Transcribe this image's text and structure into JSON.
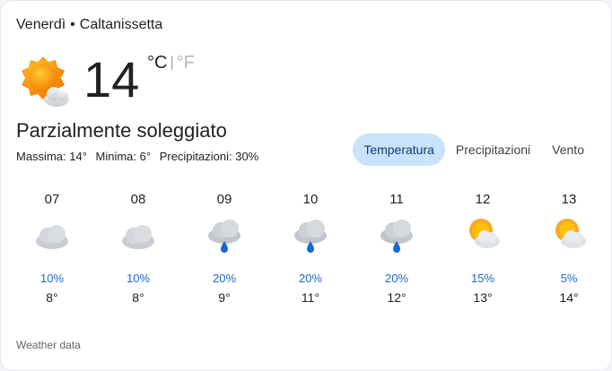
{
  "header": {
    "day": "Venerdì",
    "separator": "•",
    "location": "Caltanissetta"
  },
  "current": {
    "icon": "partly-sunny-icon",
    "temperature": "14",
    "unit_celsius": "°C",
    "unit_divider": "|",
    "unit_fahrenheit": "°F",
    "condition": "Parzialmente soleggiato",
    "max": "Massima: 14°",
    "min": "Minima: 6°",
    "precip": "Precipitazioni: 30%"
  },
  "tabs": [
    "Temperatura",
    "Precipitazioni",
    "Vento"
  ],
  "selected_tab": "Temperatura",
  "hourly": [
    {
      "time": "07",
      "icon": "cloudy-icon",
      "precip": "10%",
      "temp": "8°"
    },
    {
      "time": "08",
      "icon": "cloudy-icon",
      "precip": "10%",
      "temp": "8°"
    },
    {
      "time": "09",
      "icon": "rain-icon",
      "precip": "20%",
      "temp": "9°"
    },
    {
      "time": "10",
      "icon": "rain-icon",
      "precip": "20%",
      "temp": "11°"
    },
    {
      "time": "11",
      "icon": "rain-icon",
      "precip": "20%",
      "temp": "12°"
    },
    {
      "time": "12",
      "icon": "partly-sunny-icon",
      "precip": "15%",
      "temp": "13°"
    },
    {
      "time": "13",
      "icon": "partly-sunny-icon",
      "precip": "5%",
      "temp": "14°"
    }
  ],
  "footer": "Weather data",
  "colors": {
    "sun": "#f9a825",
    "cloud": "#cfd3d8",
    "rain_drop": "#1a67d2",
    "precip_text": "#1a67d2",
    "tab_selected_bg": "#c9e3fb"
  }
}
